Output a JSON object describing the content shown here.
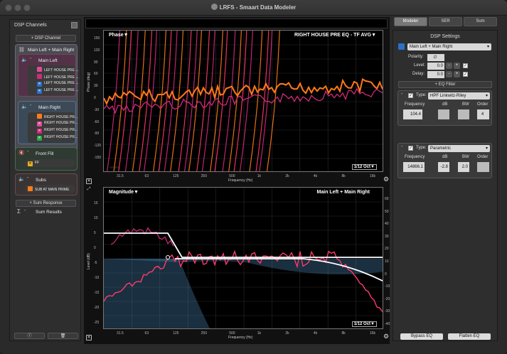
{
  "window": {
    "title": "LRFS - Smaart Data Modeler"
  },
  "left": {
    "header": "DSP Channels",
    "add_dsp": "+ DSP Channel",
    "group_main": "Main Left + Main Right",
    "main_left": "Main Left",
    "main_left_items": [
      "LEFT HOUSE PRE ...",
      "LEFT HOUSE PRE ...",
      "LEFT HOUSE PRE ...",
      "LEFT HOUSE PRE ..."
    ],
    "main_right": "Main Right",
    "main_right_items": [
      "RIGHT HOUSE PR...",
      "RIGHT HOUSE PR...",
      "RIGHT HOUSE PR...",
      "RIGHT HOUSE PR..."
    ],
    "front_fill": "Front Fill",
    "ff_item": "FF",
    "subs": "Subs",
    "subs_item": "SUB AT MAIN PRIME",
    "add_sum": "+ Sum Response",
    "sum_results": "Sum Results",
    "sigma": "Σ"
  },
  "right": {
    "tabs": [
      "Modeler",
      "SER",
      "Sum"
    ],
    "title": "DSP Settings",
    "channel_select": "Main Left + Main Right",
    "polarity_label": "Polarity:",
    "polarity_value": "∅",
    "level_label": "Level:",
    "level_value": "0.0",
    "delay_label": "Delay:",
    "delay_value": "0.0",
    "add_eq": "+ EQ Filter",
    "filter1": {
      "type_label": "Type:",
      "type": "HPF Linkwitz-Riley",
      "freq_label": "Frequency",
      "db_label": "dB",
      "bw_label": "BW",
      "order_label": "Order",
      "freq": "104.4",
      "order": "4"
    },
    "filter2": {
      "type_label": "Type:",
      "type": "Parametric",
      "freq_label": "Frequency",
      "db_label": "dB",
      "bw_label": "BW",
      "order_label": "Order",
      "freq": "14866.1",
      "db": "-2.8",
      "bw": "2.0"
    },
    "bypass": "Bypass EQ",
    "flatten": "Flatten EQ"
  },
  "phase": {
    "title": "Phase",
    "trace_label": "RIGHT HOUSE PRE EQ - TF AVG",
    "ylabel": "Phase (deg)",
    "xlabel": "Frequency (Hz)",
    "smoothing": "1/12 Oct",
    "yticks": [
      "150",
      "120",
      "90",
      "60",
      "30",
      "0",
      "-30",
      "-60",
      "-90",
      "-120",
      "-150"
    ],
    "xticks": [
      "31.5",
      "63",
      "125",
      "250",
      "500",
      "1k",
      "2k",
      "4k",
      "8k",
      "16k"
    ],
    "zoom_label": "○○ ○○"
  },
  "magnitude": {
    "title": "Magnitude",
    "trace_label": "Main Left + Main Right",
    "ylabel": "Level (dB)",
    "xlabel": "Frequency (Hz)",
    "smoothing": "1/12 Oct",
    "yticks": [
      "15",
      "10",
      "5",
      "0",
      "-5",
      "-10",
      "-15",
      "-20",
      "-25"
    ],
    "yticks_right": [
      "60",
      "50",
      "40",
      "30",
      "20",
      "10",
      "0",
      "-10",
      "-20",
      "-30",
      "-40"
    ],
    "xticks": [
      "31.5",
      "63",
      "125",
      "250",
      "500",
      "1k",
      "2k",
      "4k",
      "8k",
      "16k"
    ]
  },
  "colors": {
    "orange": "#ff7a1a",
    "magenta": "#d02a7a",
    "pink": "#ff3a6a",
    "blue": "#4a86b8",
    "accent": "#2a70c8"
  }
}
